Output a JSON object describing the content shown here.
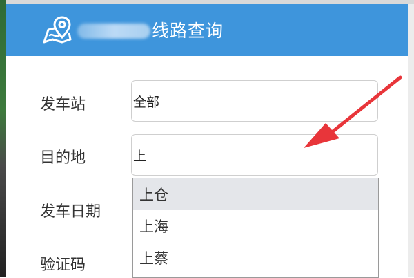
{
  "header": {
    "title": "线路查询",
    "icon": "map-pin-icon",
    "bg_color": "#3e95dc"
  },
  "form": {
    "departure": {
      "label": "发车站",
      "value": "全部"
    },
    "destination": {
      "label": "目的地",
      "value": "上"
    },
    "date": {
      "label": "发车日期"
    },
    "captcha": {
      "label": "验证码"
    }
  },
  "dropdown": {
    "options": [
      "上仓",
      "上海",
      "上蔡"
    ],
    "highlighted_index": 0
  },
  "annotation": {
    "arrow_color": "#e8353a"
  }
}
